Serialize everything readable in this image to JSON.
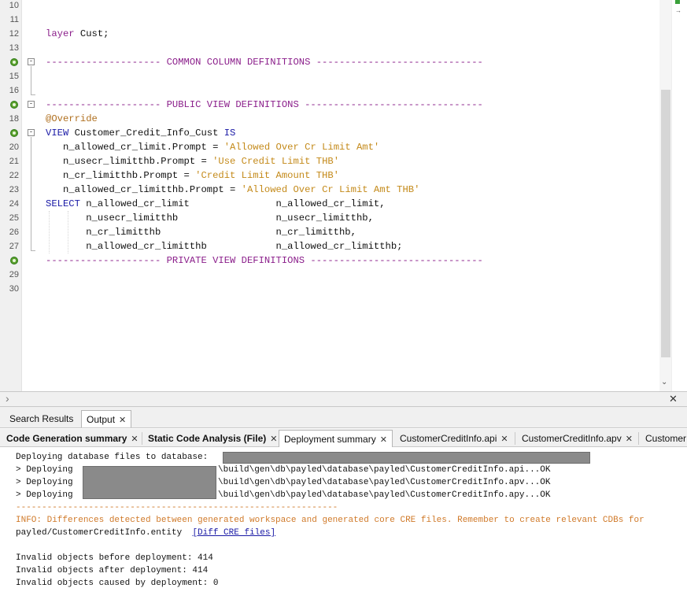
{
  "editor": {
    "top_partial_line": "10",
    "lines": [
      {
        "n": "11",
        "parts": []
      },
      {
        "n": "12",
        "parts": [
          {
            "t": "layer ",
            "c": "com"
          },
          {
            "t": "Cust;",
            "c": "plain"
          }
        ]
      },
      {
        "n": "13",
        "parts": []
      },
      {
        "n": "14",
        "parts": [
          {
            "t": "-------------------- COMMON COLUMN DEFINITIONS -----------------------------",
            "c": "com"
          }
        ]
      },
      {
        "n": "15",
        "parts": []
      },
      {
        "n": "16",
        "parts": []
      },
      {
        "n": "17",
        "parts": [
          {
            "t": "-------------------- PUBLIC VIEW DEFINITIONS -------------------------------",
            "c": "com"
          }
        ]
      },
      {
        "n": "18",
        "parts": [
          {
            "t": "@Override",
            "c": "ann"
          }
        ]
      },
      {
        "n": "19",
        "parts": [
          {
            "t": "VIEW ",
            "c": "kw"
          },
          {
            "t": "Customer_Credit_Info_Cust ",
            "c": "plain"
          },
          {
            "t": "IS",
            "c": "kw"
          }
        ]
      },
      {
        "n": "20",
        "parts": [
          {
            "t": "   n_allowed_cr_limit.Prompt = ",
            "c": "plain"
          },
          {
            "t": "'Allowed Over Cr Limit Amt'",
            "c": "str"
          }
        ]
      },
      {
        "n": "21",
        "parts": [
          {
            "t": "   n_usecr_limitthb.Prompt = ",
            "c": "plain"
          },
          {
            "t": "'Use Credit Limit THB'",
            "c": "str"
          }
        ]
      },
      {
        "n": "22",
        "parts": [
          {
            "t": "   n_cr_limitthb.Prompt = ",
            "c": "plain"
          },
          {
            "t": "'Credit Limit Amount THB'",
            "c": "str"
          }
        ]
      },
      {
        "n": "23",
        "parts": [
          {
            "t": "   n_allowed_cr_limitthb.Prompt = ",
            "c": "plain"
          },
          {
            "t": "'Allowed Over Cr Limit Amt THB'",
            "c": "str"
          }
        ]
      },
      {
        "n": "24",
        "parts": [
          {
            "t": "SELECT ",
            "c": "kw"
          },
          {
            "t": "n_allowed_cr_limit               n_allowed_cr_limit,",
            "c": "plain"
          }
        ]
      },
      {
        "n": "25",
        "parts": [
          {
            "t": "       n_usecr_limitthb                 n_usecr_limitthb,",
            "c": "plain"
          }
        ]
      },
      {
        "n": "26",
        "parts": [
          {
            "t": "       n_cr_limitthb                    n_cr_limitthb,",
            "c": "plain"
          }
        ]
      },
      {
        "n": "27",
        "parts": [
          {
            "t": "       n_allowed_cr_limitthb            n_allowed_cr_limitthb;",
            "c": "plain"
          }
        ]
      },
      {
        "n": "28",
        "parts": [
          {
            "t": "-------------------- PRIVATE VIEW DEFINITIONS ------------------------------",
            "c": "com"
          }
        ]
      },
      {
        "n": "29",
        "parts": []
      },
      {
        "n": "30",
        "parts": []
      }
    ]
  },
  "panel_tabs": [
    {
      "label": "Search Results",
      "active": false
    },
    {
      "label": "Output",
      "active": true
    }
  ],
  "output_tabs": [
    {
      "label": "Code Generation summary",
      "bold": true
    },
    {
      "label": "Static Code Analysis (File)",
      "bold": true
    },
    {
      "label": "Deployment summary",
      "bold": false,
      "active": true
    },
    {
      "label": "CustomerCreditInfo.api",
      "bold": false
    },
    {
      "label": "CustomerCreditInfo.apv",
      "bold": false
    },
    {
      "label": "Customer",
      "bold": false
    }
  ],
  "output": {
    "deploying_header": "Deploying database files to database:",
    "deploy_lines": [
      {
        "prefix": "> Deploying",
        "path": "\\build\\gen\\db\\payled\\database\\payled\\CustomerCreditInfo.api...OK"
      },
      {
        "prefix": "> Deploying",
        "path": "\\build\\gen\\db\\payled\\database\\payled\\CustomerCreditInfo.apv...OK"
      },
      {
        "prefix": "> Deploying",
        "path": "\\build\\gen\\db\\payled\\database\\payled\\CustomerCreditInfo.apy...OK"
      }
    ],
    "separator": "--------------------------------------------------------------",
    "info": "INFO: Differences detected between generated workspace and generated core CRE files. Remember to create relevant CDBs for",
    "entity_line": "payled/CustomerCreditInfo.entity",
    "diff_link": "[Diff CRE files]",
    "invalid_before": "Invalid objects before deployment: 414",
    "invalid_after": "Invalid objects after deployment: 414",
    "invalid_caused": "Invalid objects caused by deployment: 0"
  },
  "colors": {
    "keyword": "#1a1aa6",
    "comment": "#8b1f8b",
    "string": "#c48a1a",
    "info": "#d07a2a",
    "link": "#1a1aa6"
  }
}
